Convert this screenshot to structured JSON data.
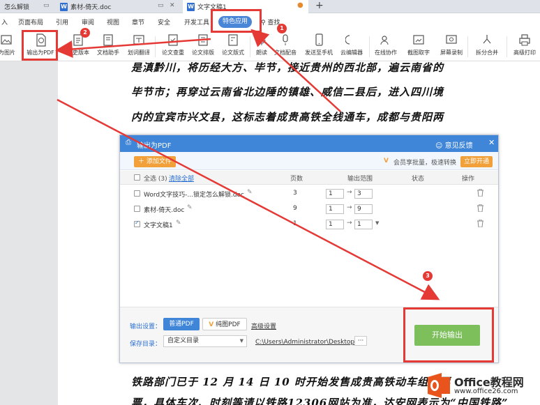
{
  "tabs": [
    {
      "label": "怎么解锁"
    },
    {
      "label": "素材-倚天.doc"
    },
    {
      "label": "文字文稿1"
    }
  ],
  "menu": {
    "items": [
      "入",
      "页面布局",
      "引用",
      "审阅",
      "视图",
      "章节",
      "安全",
      "开发工具"
    ],
    "special": "特色应用",
    "search": "查找"
  },
  "toolbar": {
    "items": [
      "为图片",
      "输出为PDF",
      "历史版本",
      "文档助手",
      "划词翻译",
      "论文查重",
      "论文排版",
      "论文版式",
      "朗读",
      "文档配音",
      "发送至手机",
      "云编辑器",
      "在线协作",
      "截图取字",
      "屏幕录制",
      "拆分合并",
      "高级打印"
    ]
  },
  "document": {
    "lines": [
      "是滇黔川，将历经大方、毕节，接近贵州的西北部，遍云南省的",
      "毕节市；再穿过云南省北边陲的镇雄、威信二县后，进入四川境",
      "内的宜宾市兴文县，这标志着成贵高铁全线通车，成都与贵阳两"
    ],
    "bottom_lines": [
      "铁路部门已于 12 月 14 日 10 时开始发售成贵高铁动车组车票",
      "票，具体车次、时刻等请以铁路12306网站为准，达安网表示为“中国铁路”"
    ]
  },
  "dialog": {
    "title": "输出为PDF",
    "feedback": "意见反馈",
    "add_file": "添加文件",
    "vip_text": "会员享批量，极速转换",
    "vip_button": "立即开通",
    "headers": {
      "select_all": "全选 (3)",
      "clear": "清除全部",
      "pages": "页数",
      "range": "输出范围",
      "status": "状态",
      "action": "操作"
    },
    "files": [
      {
        "name": "Word文字技巧-...锁定怎么解锁.doc",
        "pages": "3",
        "from": "1",
        "to": "3",
        "checked": false
      },
      {
        "name": "素材-倚天.doc",
        "pages": "9",
        "from": "1",
        "to": "9",
        "checked": false
      },
      {
        "name": "文字文稿1",
        "pages": "1",
        "from": "1",
        "to": "1",
        "checked": true
      }
    ],
    "footer": {
      "output_setting": "输出设置：",
      "normal_pdf": "普通PDF",
      "pure_pdf": "纯图PDF",
      "advanced": "高级设置",
      "save_dir": "保存目录：",
      "dir_mode": "自定义目录",
      "path": "C:\\Users\\Administrator\\Desktop\\",
      "more": "···",
      "start": "开始输出"
    }
  },
  "badges": [
    "1",
    "2",
    "3"
  ],
  "watermark": {
    "brand": "Office教程网",
    "url": "www.office26.com"
  },
  "colors": {
    "accent": "#3f85d8",
    "orange": "#f2a03a",
    "green": "#7cbf5b",
    "red": "#e53935"
  }
}
